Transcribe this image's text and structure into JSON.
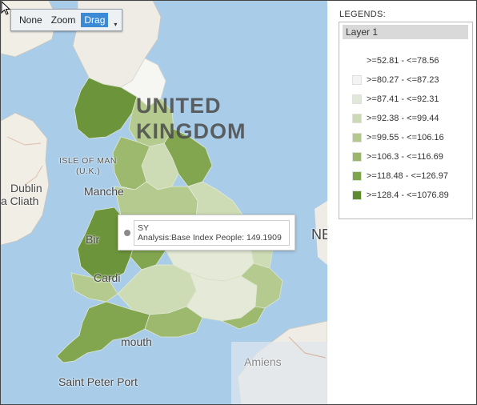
{
  "toolbar": {
    "buttons": [
      {
        "label": "None",
        "active": false
      },
      {
        "label": "Zoom",
        "active": false
      },
      {
        "label": "Drag",
        "active": true
      }
    ],
    "dropdown_icon": "caret-down-icon"
  },
  "map": {
    "labels": {
      "united": "UNITED",
      "kingdom": "KINGDOM",
      "isle_of_man": "ISLE OF MAN",
      "uk": "(U.K.)",
      "dublin": "Dublin",
      "baile": "a Cliath",
      "manchester": "Manche",
      "bir": "Bir",
      "cardiff": "Cardi",
      "plymouth": "mouth",
      "saint_peter_port": "Saint Peter Port",
      "amiens": "Amiens",
      "ne": "NE"
    },
    "region_colors": {
      "lightest": "#f6f7f2",
      "light": "#e4ead7",
      "pale": "#cedcb6",
      "mid": "#b4ca8e",
      "medium": "#9cb96d",
      "dark": "#82a650",
      "darker": "#6c943a",
      "darkest": "#5c872c"
    }
  },
  "tooltip": {
    "title": "SY",
    "text": "Analysis:Base Index People: 149.1909"
  },
  "legend": {
    "title": "LEGENDS:",
    "layer_name": "Layer 1",
    "items": [
      {
        "label": ">=52.81 - <=78.56",
        "color": "#ffffff"
      },
      {
        "label": ">=80.27 - <=87.23",
        "color": "#f3f3f1"
      },
      {
        "label": ">=87.41 - <=92.31",
        "color": "#e2e8d6"
      },
      {
        "label": ">=92.38 - <=99.44",
        "color": "#cbd9b4"
      },
      {
        "label": ">=99.55 - <=106.16",
        "color": "#b2c88c"
      },
      {
        "label": ">=106.3 - <=116.69",
        "color": "#98b76a"
      },
      {
        "label": ">=118.48 - <=126.97",
        "color": "#7ea54c"
      },
      {
        "label": ">=128.4 - <=1076.89",
        "color": "#5e8a2e"
      }
    ]
  }
}
